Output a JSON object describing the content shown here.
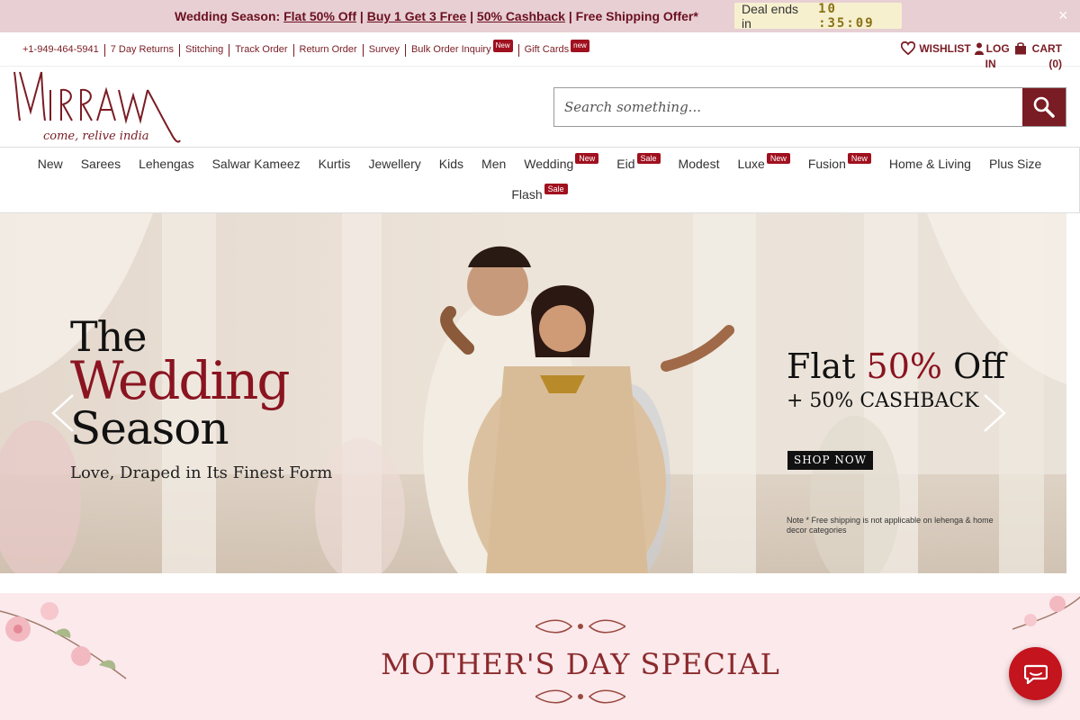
{
  "promo": {
    "prefix": "Wedding Season:",
    "offer1": "Flat 50% Off",
    "sep1": "|",
    "offer2": "Buy 1 Get 3 Free",
    "sep2": "|",
    "offer3": "50% Cashback",
    "suffix": "| Free Shipping Offer*",
    "deal_label": "Deal ends in",
    "timer": "10 :35:09",
    "close": "×"
  },
  "utility": {
    "links": [
      {
        "label": "+1-949-464-5941"
      },
      {
        "label": "7 Day Returns"
      },
      {
        "label": "Stitching"
      },
      {
        "label": "Track Order"
      },
      {
        "label": "Return Order"
      },
      {
        "label": "Survey"
      },
      {
        "label": "Bulk Order Inquiry",
        "tag": "New"
      },
      {
        "label": "Gift Cards",
        "tag": "new"
      }
    ],
    "wishlist": "WISHLIST",
    "login_line1": "LOG",
    "login_line2": "IN",
    "cart_line1": "CART",
    "cart_line2": "(0)"
  },
  "header": {
    "logo_text": "MIRRAW",
    "logo_tagline": "come, relive india",
    "search_placeholder": "Search something..."
  },
  "nav": {
    "row1": [
      {
        "label": "New"
      },
      {
        "label": "Sarees"
      },
      {
        "label": "Lehengas"
      },
      {
        "label": "Salwar Kameez"
      },
      {
        "label": "Kurtis"
      },
      {
        "label": "Jewellery"
      },
      {
        "label": "Kids"
      },
      {
        "label": "Men"
      },
      {
        "label": "Wedding",
        "tag": "New"
      },
      {
        "label": "Eid",
        "tag": "Sale"
      },
      {
        "label": "Modest"
      },
      {
        "label": "Luxe",
        "tag": "New"
      },
      {
        "label": "Fusion",
        "tag": "New"
      },
      {
        "label": "Home & Living"
      },
      {
        "label": "Plus Size"
      }
    ],
    "row2": [
      {
        "label": "Flash",
        "tag": "Sale"
      }
    ]
  },
  "hero": {
    "title1": "The",
    "title2": "Wedding",
    "title3": "Season",
    "subtitle": "Love, Draped in Its Finest Form",
    "offer_prefix": "Flat",
    "offer_pct": "50%",
    "offer_suffix": "Off",
    "offer2": "+ 50% CASHBACK",
    "cta": "SHOP NOW",
    "note": "Note * Free shipping is not applicable on lehenga & home decor categories"
  },
  "section": {
    "title": "MOTHER'S DAY SPECIAL"
  },
  "colors": {
    "brand": "#7a1c24",
    "promo_bg": "#e7cfd3",
    "tag_red": "#a0101e",
    "section_bg": "#fbe9ec",
    "chat_red": "#c4141e"
  }
}
